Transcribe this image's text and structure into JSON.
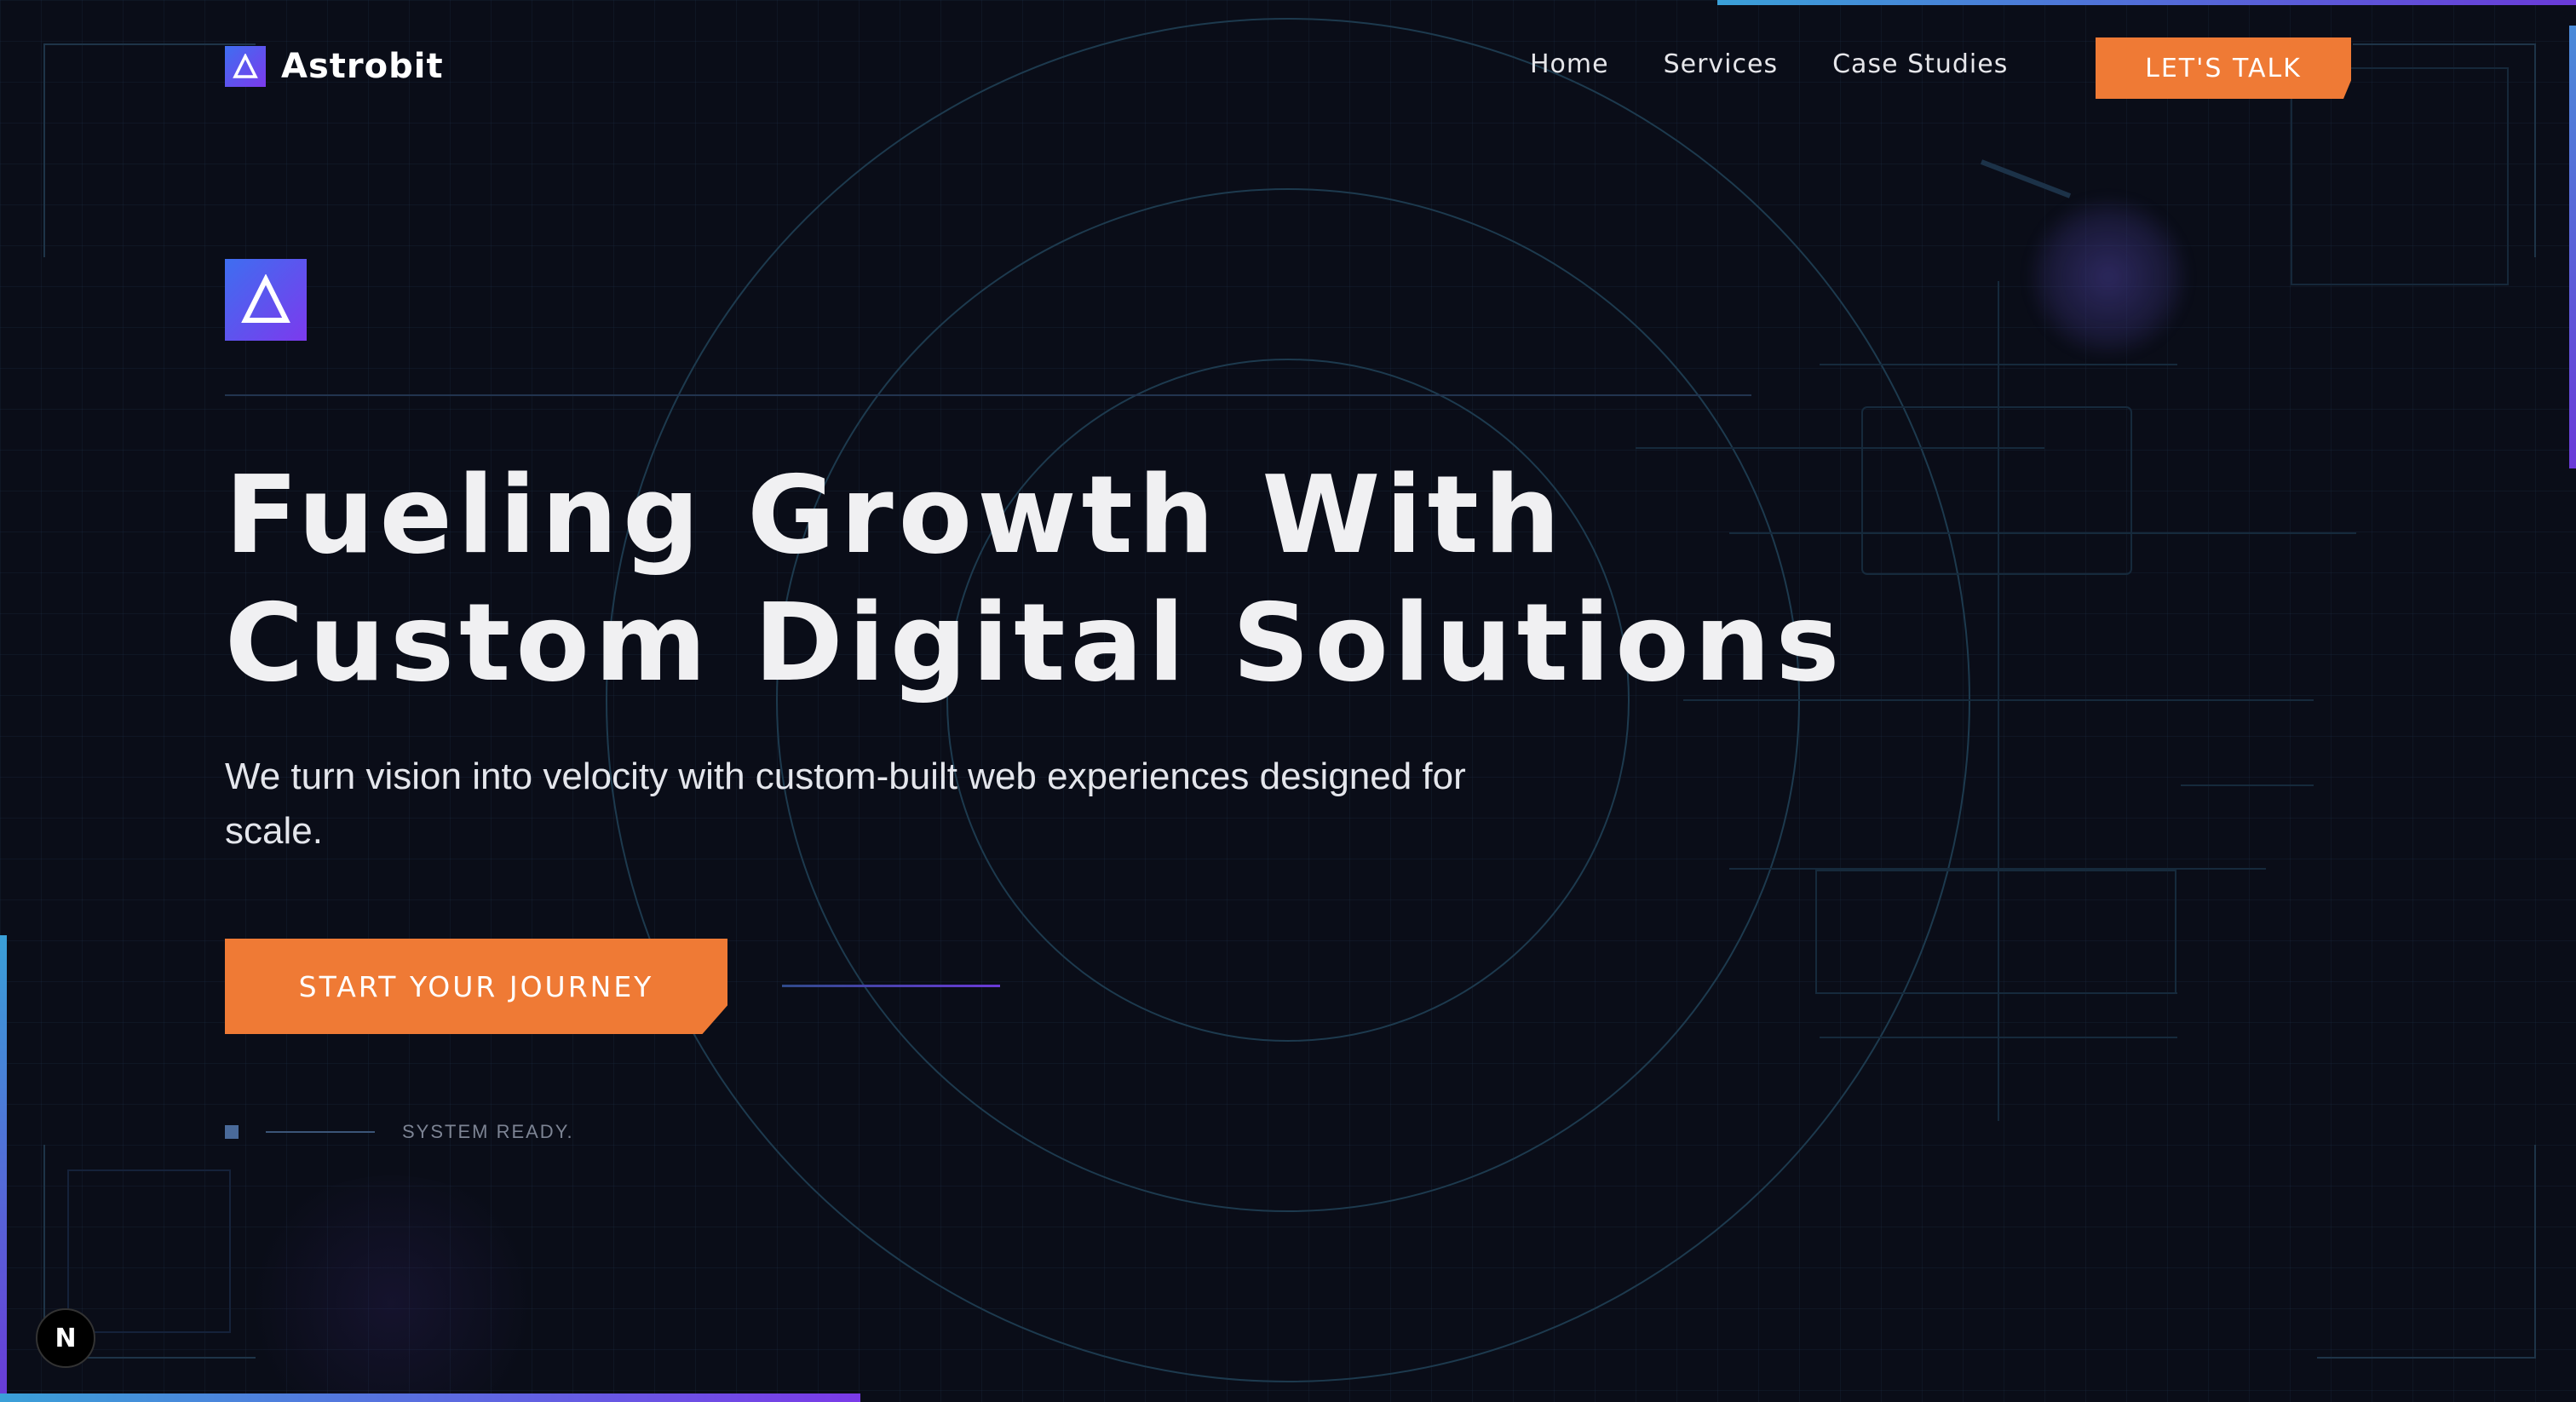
{
  "brand": {
    "name": "Astrobit",
    "logo_icon": "delta-icon"
  },
  "nav": {
    "links": [
      "Home",
      "Services",
      "Case Studies"
    ],
    "cta_label": "LET'S TALK"
  },
  "hero": {
    "icon": "delta-icon",
    "headline_line1": "Fueling Growth With",
    "headline_line2": "Custom Digital Solutions",
    "subtext": "We turn vision into velocity with custom-built web experiences designed for scale.",
    "cta_label": "START YOUR JOURNEY",
    "status_text": "SYSTEM READY."
  },
  "badge": {
    "label": "N"
  },
  "colors": {
    "background": "#0a0d18",
    "accent_orange": "#ef7a35",
    "brand_gradient_start": "#3e6ef0",
    "brand_gradient_end": "#7c3aed",
    "line_teal": "#1d3a4e"
  }
}
